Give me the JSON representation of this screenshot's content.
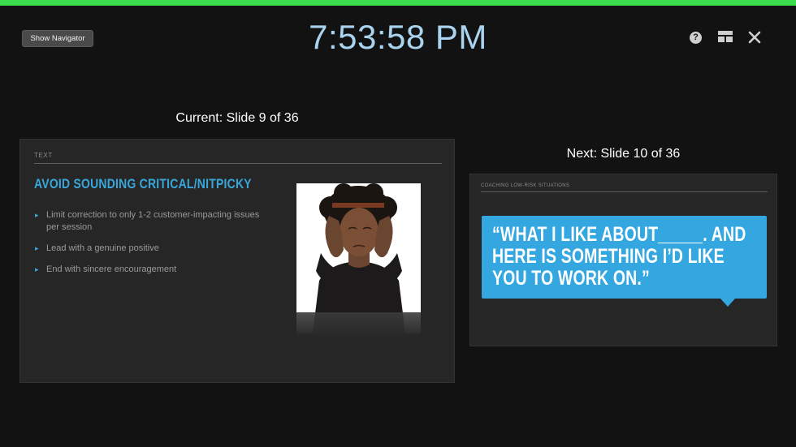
{
  "top_bar_color": "#3cdc4e",
  "toolbar": {
    "show_navigator_label": "Show Navigator",
    "help_icon": "question-circle-icon",
    "layout_icon": "layout-grid-icon",
    "close_icon": "close-icon"
  },
  "clock": "7:53:58 PM",
  "current": {
    "label": "Current: Slide 9 of 36",
    "slide": {
      "header": "TEXT",
      "title": "AVOID SOUNDING CRITICAL/NITPICKY",
      "bullets": [
        "Limit correction to only 1-2 customer-impacting issues per session",
        "Lead with a genuine positive",
        "End with sincere encouragement"
      ],
      "image": "woman-covering-ears-photo"
    }
  },
  "next": {
    "label": "Next: Slide 10 of 36",
    "slide": {
      "header": "COACHING LOW-RISK SITUATIONS",
      "quote": "“WHAT I LIKE ABOUT_____. AND HERE IS SOMETHING I’D LIKE YOU TO WORK ON.”"
    }
  },
  "colors": {
    "accent_blue": "#38a8dc",
    "bubble_blue": "#34a7e0",
    "clock_blue": "#a9d3ee",
    "background": "#121212"
  }
}
